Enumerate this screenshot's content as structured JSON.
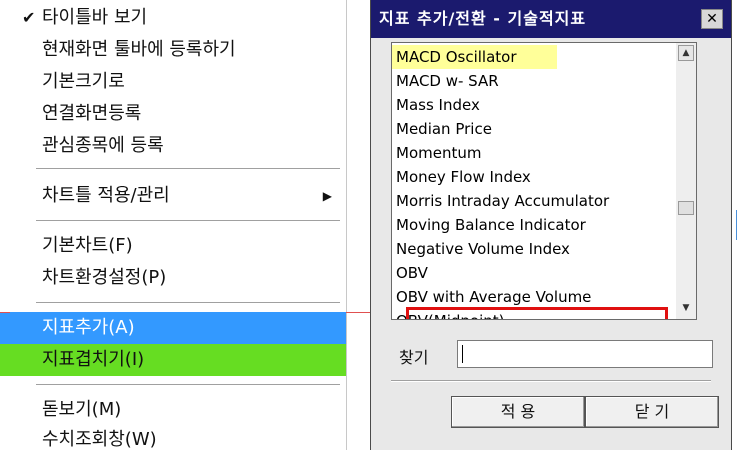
{
  "menu": {
    "items": [
      {
        "label": "타이틀바 보기",
        "checked": true
      },
      {
        "label": "현재화면 툴바에 등록하기"
      },
      {
        "label": "기본크기로"
      },
      {
        "label": "연결화면등록"
      },
      {
        "label": "관심종목에 등록"
      },
      {
        "label": "차트틀 적용/관리",
        "submenu": true
      },
      {
        "label": "기본차트(F)"
      },
      {
        "label": "차트환경설정(P)"
      },
      {
        "label": "지표추가(A)",
        "highlight": "blue"
      },
      {
        "label": "지표겹치기(I)",
        "highlight": "green"
      },
      {
        "label": "돋보기(M)"
      },
      {
        "label": "수치조회창(W)"
      }
    ],
    "colors": {
      "highlight_blue": "#3399ff",
      "highlight_green": "#66dd22"
    }
  },
  "dialog": {
    "title": "지표 추가/전환 - 기술적지표",
    "close_icon": "✕",
    "list": [
      {
        "label": "MACD Oscillator",
        "selected": true
      },
      {
        "label": "MACD w- SAR"
      },
      {
        "label": "Mass Index"
      },
      {
        "label": "Median Price"
      },
      {
        "label": "Momentum"
      },
      {
        "label": "Money Flow Index"
      },
      {
        "label": "Morris Intraday Accumulator"
      },
      {
        "label": "Moving Balance Indicator"
      },
      {
        "label": "Negative Volume Index"
      },
      {
        "label": "OBV"
      },
      {
        "label": "OBV with Average Volume"
      },
      {
        "label": "OBV(Midpoint)"
      }
    ],
    "find_label": "찾기",
    "find_value": "",
    "apply_button": "적 용",
    "close_button": "닫 기",
    "colors": {
      "titlebar": "#1b1a6e",
      "selected_item": "#ffff99",
      "highlight_box": "#e01010"
    }
  }
}
